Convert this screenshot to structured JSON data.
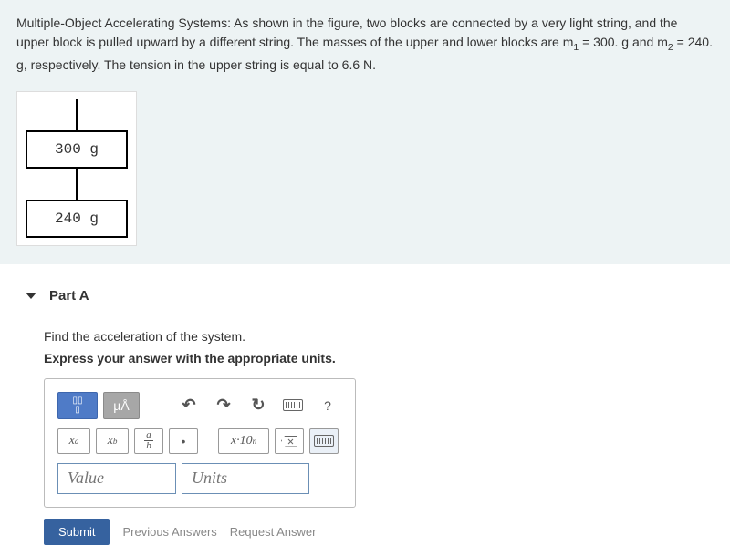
{
  "problem": {
    "text_html": "Multiple-Object Accelerating Systems: As shown in the figure, two blocks are connected by a very light string, and the upper block is pulled upward by a different string. The masses of the upper and lower blocks are m<sub>1</sub> = 300. g and m<sub>2</sub> = 240. g, respectively.  The tension in the upper string is equal to 6.6 N."
  },
  "figure": {
    "top_block": "300 g",
    "bottom_block": "240 g"
  },
  "part": {
    "label": "Part A",
    "prompt": "Find the acceleration of the system.",
    "instruction": "Express your answer with the appropriate units."
  },
  "toolbar": {
    "templates_icon": "templates",
    "mu_angstrom": "µÅ",
    "undo": "↶",
    "redo": "↷",
    "reset": "↻",
    "keyboard": "keyboard",
    "help": "?",
    "superscript": "xᵃ",
    "subscript": "x_b",
    "fraction_top": "a",
    "fraction_bot": "b",
    "dot": "•",
    "scientific": "x·10ⁿ",
    "delete": "⌫",
    "keyboard2": "keyboard"
  },
  "inputs": {
    "value_placeholder": "Value",
    "units_placeholder": "Units"
  },
  "buttons": {
    "submit": "Submit",
    "previous": "Previous Answers",
    "request": "Request Answer"
  }
}
